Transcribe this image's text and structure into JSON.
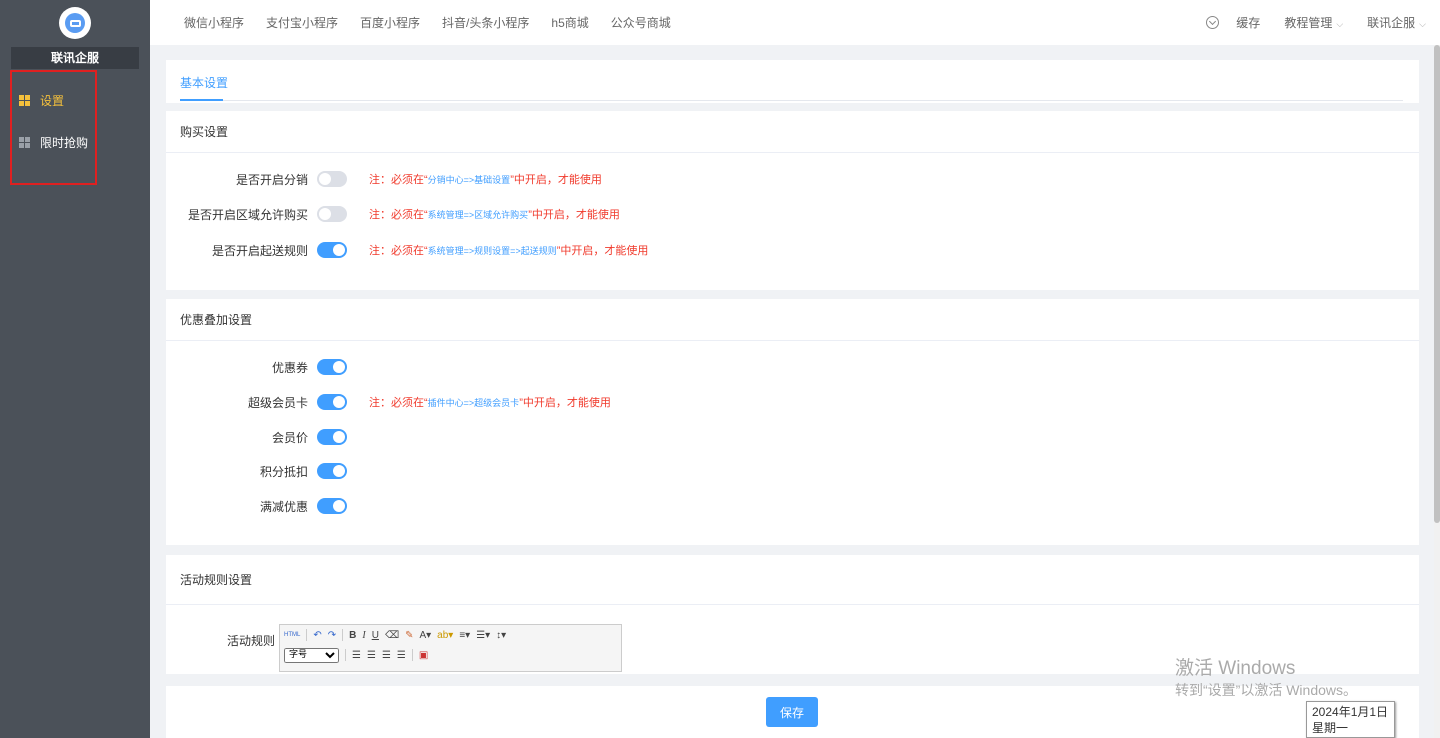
{
  "sidebar": {
    "brand": "联讯企服",
    "items": [
      {
        "label": "设置"
      },
      {
        "label": "限时抢购"
      }
    ]
  },
  "topbar": {
    "nav": [
      "微信小程序",
      "支付宝小程序",
      "百度小程序",
      "抖音/头条小程序",
      "h5商城",
      "公众号商城"
    ],
    "cache": "缓存",
    "tutorial": "教程管理",
    "user": "联讯企服"
  },
  "tabs": {
    "active": "基本设置"
  },
  "purchase": {
    "title": "购买设置",
    "rows": [
      {
        "label": "是否开启分销",
        "on": false,
        "note_pre": "注：必须在“",
        "note_path": "分销中心=>基础设置",
        "note_post": "”中开启，才能使用"
      },
      {
        "label": "是否开启区域允许购买",
        "on": false,
        "note_pre": "注：必须在“",
        "note_path": "系统管理=>区域允许购买",
        "note_post": "”中开启，才能使用"
      },
      {
        "label": "是否开启起送规则",
        "on": true,
        "note_pre": "注：必须在“",
        "note_path": "系统管理=>规则设置=>起送规则",
        "note_post": "”中开启，才能使用"
      }
    ]
  },
  "discount": {
    "title": "优惠叠加设置",
    "rows": [
      {
        "label": "优惠券",
        "on": true
      },
      {
        "label": "超级会员卡",
        "on": true,
        "note_pre": "注：必须在“",
        "note_path": "插件中心=>超级会员卡",
        "note_post": "”中开启，才能使用"
      },
      {
        "label": "会员价",
        "on": true
      },
      {
        "label": "积分抵扣",
        "on": true
      },
      {
        "label": "满减优惠",
        "on": true
      }
    ]
  },
  "rules": {
    "title": "活动规则设置",
    "label": "活动规则",
    "font_size": "字号"
  },
  "footer": {
    "save": "保存"
  },
  "watermark": {
    "line1": "激活 Windows",
    "line2": "转到“设置”以激活 Windows。"
  },
  "clock": {
    "date": "2024年1月1日",
    "weekday": "星期一"
  },
  "colors": {
    "accent": "#409eff",
    "note": "#f03a2c",
    "sidebar": "#4b5159",
    "active_nav": "#f5c13c"
  }
}
